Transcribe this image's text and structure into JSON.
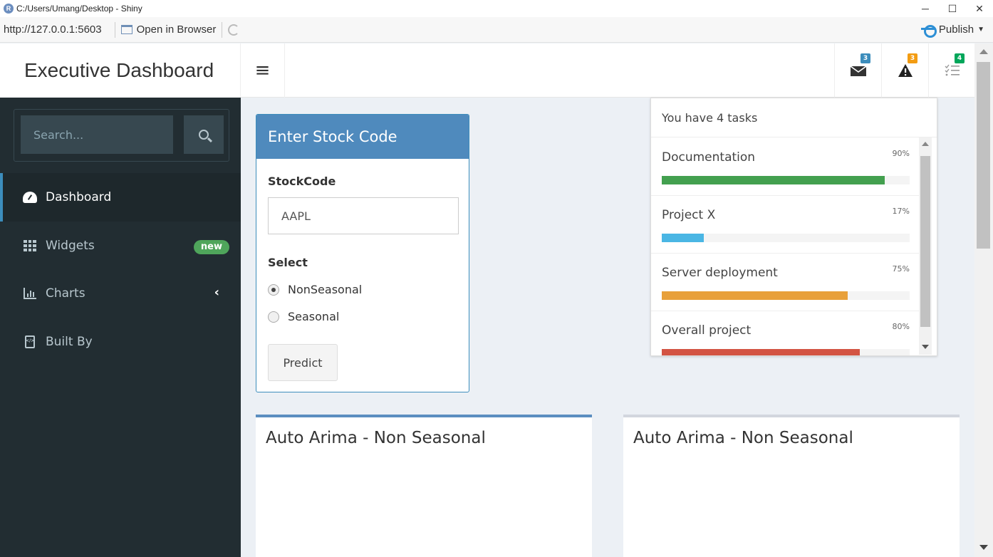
{
  "window": {
    "title": "C:/Users/Umang/Desktop - Shiny",
    "min": "─",
    "max": "☐",
    "close": "✕"
  },
  "viewer": {
    "url": "http://127.0.0.1:5603",
    "open_label": "Open in Browser",
    "publish_label": "Publish"
  },
  "header": {
    "title": "Executive Dashboard",
    "hamburger": "≡"
  },
  "notifications": {
    "messages": {
      "count": "3",
      "color": "#3c8dbc"
    },
    "warnings": {
      "count": "3",
      "color": "#f39c12"
    },
    "tasks": {
      "count": "4",
      "color": "#00a65a"
    }
  },
  "sidebar": {
    "search_placeholder": "Search...",
    "items": [
      {
        "label": "Dashboard",
        "icon": "dashboard-icon",
        "active": true
      },
      {
        "label": "Widgets",
        "icon": "grid-icon",
        "badge": "new"
      },
      {
        "label": "Charts",
        "icon": "bar-chart-icon",
        "chevron": "‹"
      },
      {
        "label": "Built By",
        "icon": "file-code-icon"
      }
    ]
  },
  "stockbox": {
    "title": "Enter Stock Code",
    "field_label": "StockCode",
    "field_value": "AAPL",
    "select_label": "Select",
    "options": [
      {
        "label": "NonSeasonal",
        "selected": true
      },
      {
        "label": "Seasonal",
        "selected": false
      }
    ],
    "button": "Predict"
  },
  "tasks_menu": {
    "header": "You have 4 tasks",
    "items": [
      {
        "name": "Documentation",
        "pct_label": "90%",
        "progress": 0.9,
        "color": "#43a04f"
      },
      {
        "name": "Project X",
        "pct_label": "17%",
        "progress": 0.17,
        "color": "#4ab6e4"
      },
      {
        "name": "Server deployment",
        "pct_label": "75%",
        "progress": 0.75,
        "color": "#e8a03a"
      },
      {
        "name": "Overall project",
        "pct_label": "80%",
        "progress": 0.8,
        "color": "#d35443"
      }
    ]
  },
  "boxes": [
    {
      "title": "Auto Arima - Non Seasonal",
      "accent": "#5b8ec0"
    },
    {
      "title": "Auto Arima - Non Seasonal",
      "accent": "#d2d6de"
    }
  ]
}
